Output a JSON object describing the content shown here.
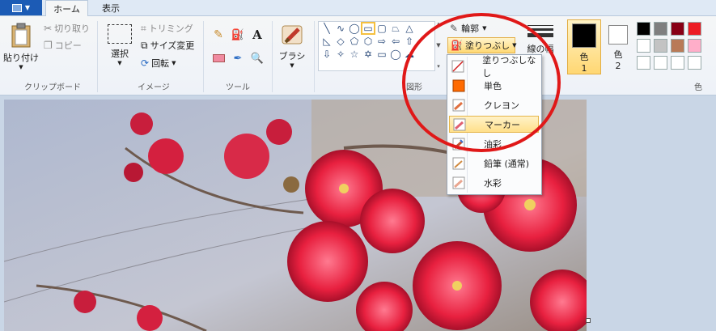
{
  "tabs": {
    "file_label": "",
    "home": "ホーム",
    "view": "表示"
  },
  "clipboard": {
    "paste": "貼り付け",
    "cut": "切り取り",
    "copy": "コピー",
    "group": "クリップボード"
  },
  "image": {
    "select": "選択",
    "crop": "トリミング",
    "resize": "サイズ変更",
    "rotate": "回転",
    "group": "イメージ"
  },
  "tools": {
    "group": "ツール"
  },
  "brushes": {
    "label": "ブラシ"
  },
  "shapes": {
    "outline": "輪郭",
    "fill": "塗りつぶし",
    "group": "図形"
  },
  "size": {
    "label": "線の幅"
  },
  "colors": {
    "color1": "色",
    "color1_num": "1",
    "color2": "色",
    "color2_num": "2",
    "group": "色",
    "palette_row1": [
      "#000000",
      "#7f7f7f",
      "#880015",
      "#ed1c24"
    ],
    "palette_row2": [
      "#ffffff",
      "#c3c3c3",
      "#b97a57",
      "#ffaec9"
    ],
    "palette_row3": [
      "#ffffff",
      "#ffffff",
      "#ffffff",
      "#ffffff"
    ]
  },
  "fill_menu": {
    "items": [
      "塗りつぶしなし",
      "単色",
      "クレヨン",
      "マーカー",
      "油彩",
      "鉛筆 (通常)",
      "水彩"
    ],
    "highlighted": "マーカー"
  }
}
